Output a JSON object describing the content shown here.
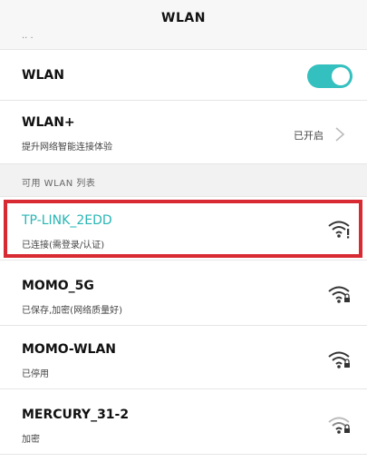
{
  "header": {
    "title": "WLAN",
    "clipped_text": "·· ·"
  },
  "wlan": {
    "label": "WLAN",
    "enabled": true
  },
  "wlan_plus": {
    "label": "WLAN+",
    "subtitle": "提升网络智能连接体验",
    "status": "已开启"
  },
  "available_section": {
    "label": "可用 WLAN 列表"
  },
  "networks": [
    {
      "ssid": "TP-LINK_2EDD",
      "status": "已连接(需登录/认证)",
      "icon": "wifi-alert-icon"
    },
    {
      "ssid": "MOMO_5G",
      "status": "已保存,加密(网络质量好)",
      "icon": "wifi-lock-icon"
    },
    {
      "ssid": "MOMO-WLAN",
      "status": "已停用",
      "icon": "wifi-lock-icon"
    },
    {
      "ssid": "MERCURY_31-2",
      "status": "加密",
      "icon": "wifi-lock-icon"
    }
  ],
  "colors": {
    "accent": "#35c0c0",
    "connected_text": "#27b6b4",
    "highlight_border": "#d82a33"
  }
}
